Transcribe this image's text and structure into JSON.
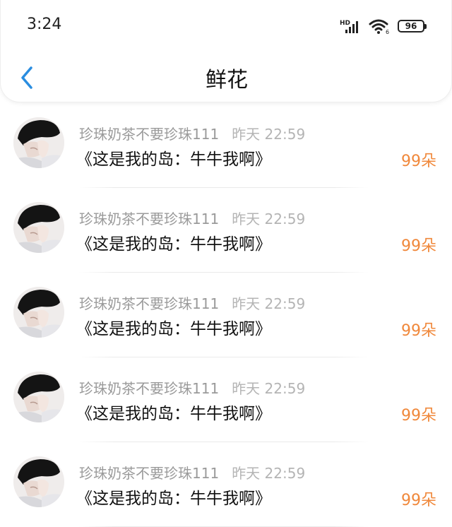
{
  "status_bar": {
    "time": "3:24",
    "network_label": "HD",
    "battery": "96"
  },
  "header": {
    "title": "鲜花"
  },
  "colors": {
    "accent_blue": "#2a8de0",
    "count_orange": "#f0883b"
  },
  "items": [
    {
      "user": "珍珠奶茶不要珍珠111",
      "time": "昨天 22:59",
      "message": "《这是我的岛：牛牛我啊》",
      "count": "99朵"
    },
    {
      "user": "珍珠奶茶不要珍珠111",
      "time": "昨天 22:59",
      "message": "《这是我的岛：牛牛我啊》",
      "count": "99朵"
    },
    {
      "user": "珍珠奶茶不要珍珠111",
      "time": "昨天 22:59",
      "message": "《这是我的岛：牛牛我啊》",
      "count": "99朵"
    },
    {
      "user": "珍珠奶茶不要珍珠111",
      "time": "昨天 22:59",
      "message": "《这是我的岛：牛牛我啊》",
      "count": "99朵"
    },
    {
      "user": "珍珠奶茶不要珍珠111",
      "time": "昨天 22:59",
      "message": "《这是我的岛：牛牛我啊》",
      "count": "99朵"
    }
  ]
}
